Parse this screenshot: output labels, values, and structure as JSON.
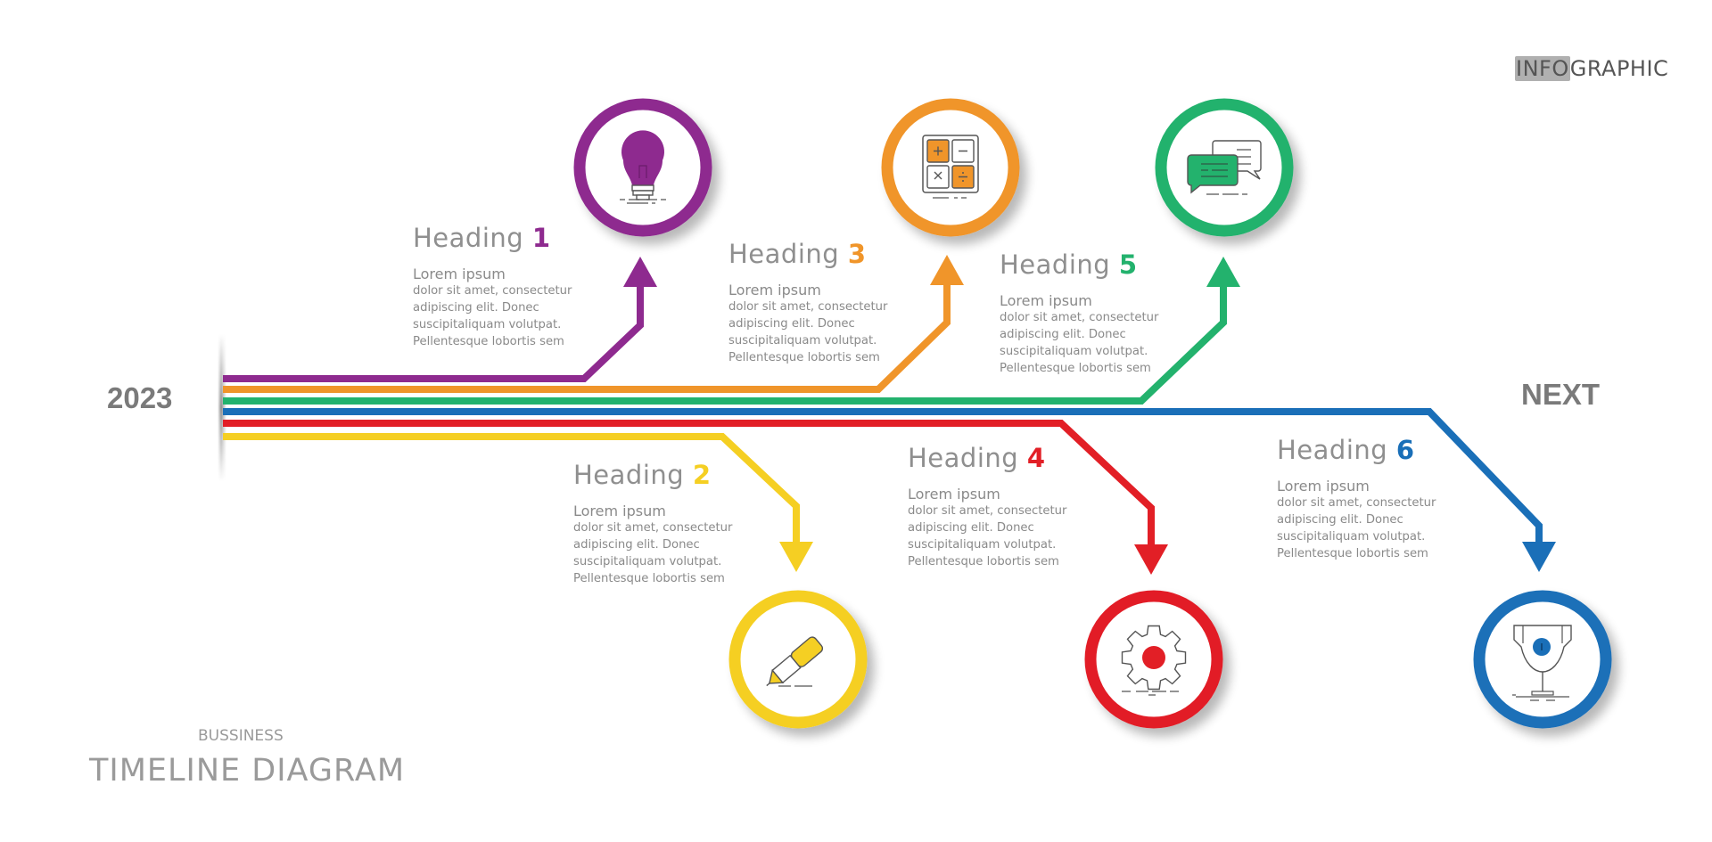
{
  "brand": {
    "highlight": "INFO",
    "rest": "GRAPHIC"
  },
  "start_label": "2023",
  "end_label": "NEXT",
  "footer": {
    "subtitle": "BUSSINESS",
    "title": "TIMELINE DIAGRAM"
  },
  "colors": {
    "purple": "#8e2a8f",
    "orange": "#f0952a",
    "green": "#23b26d",
    "blue": "#1a6fb8",
    "red": "#e21f26",
    "yellow": "#f5cf23"
  },
  "steps": [
    {
      "id": 1,
      "word": "Heading",
      "number": "1",
      "color": "#8e2a8f",
      "direction": "up",
      "icon": "lightbulb-icon",
      "lead": "Lorem ipsum",
      "lines": [
        "dolor sit amet, consectetur",
        "adipiscing elit. Donec",
        "suscipitaliquam volutpat.",
        "Pellentesque lobortis sem"
      ]
    },
    {
      "id": 2,
      "word": "Heading",
      "number": "2",
      "color": "#f5cf23",
      "direction": "down",
      "icon": "pen-icon",
      "lead": "Lorem ipsum",
      "lines": [
        "dolor sit amet, consectetur",
        "adipiscing elit. Donec",
        "suscipitaliquam volutpat.",
        "Pellentesque lobortis sem"
      ]
    },
    {
      "id": 3,
      "word": "Heading",
      "number": "3",
      "color": "#f0952a",
      "direction": "up",
      "icon": "calculator-icon",
      "lead": "Lorem ipsum",
      "lines": [
        "dolor sit amet, consectetur",
        "adipiscing elit. Donec",
        "suscipitaliquam volutpat.",
        "Pellentesque lobortis sem"
      ]
    },
    {
      "id": 4,
      "word": "Heading",
      "number": "4",
      "color": "#e21f26",
      "direction": "down",
      "icon": "gear-icon",
      "lead": "Lorem ipsum",
      "lines": [
        "dolor sit amet, consectetur",
        "adipiscing elit. Donec",
        "suscipitaliquam volutpat.",
        "Pellentesque lobortis sem"
      ]
    },
    {
      "id": 5,
      "word": "Heading",
      "number": "5",
      "color": "#23b26d",
      "direction": "up",
      "icon": "chat-bubbles-icon",
      "lead": "Lorem ipsum",
      "lines": [
        "dolor sit amet, consectetur",
        "adipiscing elit. Donec",
        "suscipitaliquam volutpat.",
        "Pellentesque lobortis sem"
      ]
    },
    {
      "id": 6,
      "word": "Heading",
      "number": "6",
      "color": "#1a6fb8",
      "direction": "down",
      "icon": "trophy-icon",
      "lead": "Lorem ipsum",
      "lines": [
        "dolor sit amet, consectetur",
        "adipiscing elit. Donec",
        "suscipitaliquam volutpat.",
        "Pellentesque lobortis sem"
      ]
    }
  ]
}
